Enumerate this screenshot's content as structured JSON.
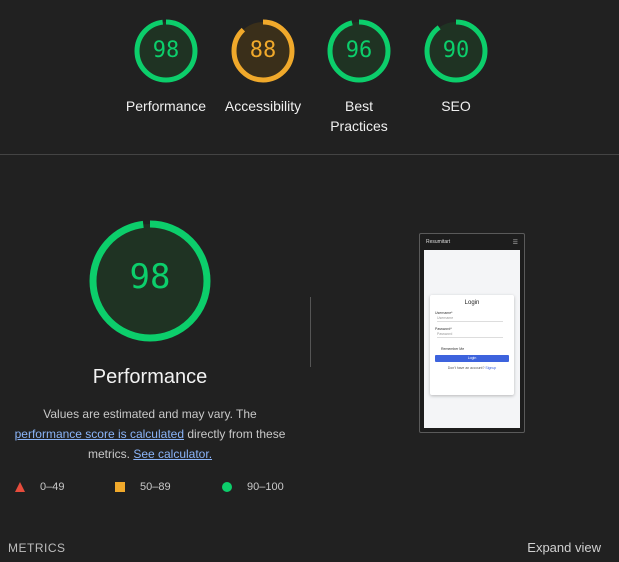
{
  "summary": {
    "gauges": [
      {
        "score": "98",
        "label": "Performance",
        "color": "#0cce6b",
        "fill": 0.98
      },
      {
        "score": "88",
        "label": "Accessibility",
        "color": "#f0a92b",
        "fill": 0.88
      },
      {
        "score": "96",
        "label": "Best Practices",
        "color": "#0cce6b",
        "fill": 0.96
      },
      {
        "score": "90",
        "label": "SEO",
        "color": "#0cce6b",
        "fill": 0.9
      }
    ]
  },
  "performance": {
    "score": "98",
    "fill": 0.98,
    "color": "#0cce6b",
    "title": "Performance",
    "desc_line1": "Values are estimated and may vary. The",
    "desc_link1": "performance score is calculated",
    "desc_mid": " directly from these metrics. ",
    "desc_link2": "See calculator."
  },
  "legend": {
    "fail": "0–49",
    "average": "50–89",
    "pass": "90–100",
    "colors": {
      "fail": "#e74c3c",
      "average": "#f0a92b",
      "pass": "#0cce6b"
    }
  },
  "screenshot": {
    "app_name": "Resumitart",
    "menu_icon": "hamburger-icon",
    "card_title": "Login",
    "username_label": "Username*",
    "username_placeholder": "Username",
    "password_label": "Password*",
    "password_placeholder": "Password",
    "remember": "Remember Me",
    "login_button": "Login",
    "signup_text": "Don't have an account? ",
    "signup_link": "Signup"
  },
  "metrics": {
    "heading": "METRICS",
    "expand": "Expand view"
  }
}
